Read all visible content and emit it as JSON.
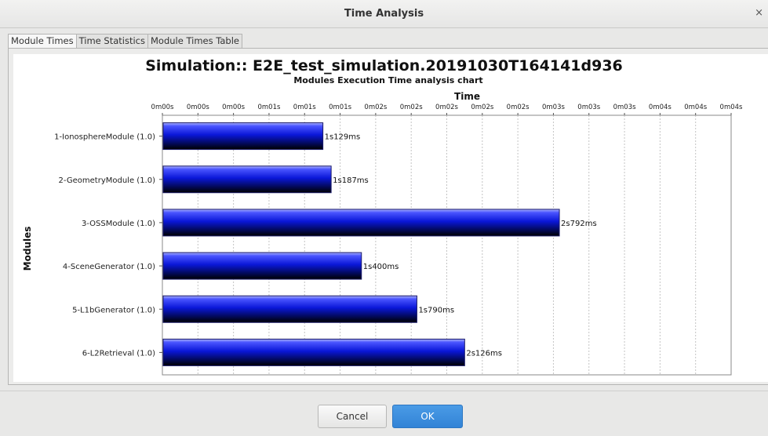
{
  "window": {
    "title": "Time Analysis",
    "close_glyph": "×"
  },
  "tabs": [
    {
      "label": "Module Times",
      "active": true
    },
    {
      "label": "Time Statistics",
      "active": false
    },
    {
      "label": "Module Times Table",
      "active": false
    }
  ],
  "chart_data": {
    "type": "bar",
    "orientation": "horizontal",
    "title": "Simulation:: E2E_test_simulation.20191030T164141d936",
    "subtitle": "Modules Execution Time analysis chart",
    "xlabel": "Time",
    "ylabel": "Modules",
    "x_tick_labels": [
      "0m00s",
      "0m00s",
      "0m00s",
      "0m01s",
      "0m01s",
      "0m01s",
      "0m02s",
      "0m02s",
      "0m02s",
      "0m02s",
      "0m02s",
      "0m03s",
      "0m03s",
      "0m03s",
      "0m04s",
      "0m04s",
      "0m04s"
    ],
    "xlim": [
      0,
      4.0
    ],
    "categories": [
      "1-IonosphereModule (1.0)",
      "2-GeometryModule (1.0)",
      "3-OSSModule (1.0)",
      "4-SceneGenerator (1.0)",
      "5-L1bGenerator (1.0)",
      "6-L2Retrieval (1.0)"
    ],
    "values": [
      1.129,
      1.187,
      2.792,
      1.4,
      1.79,
      2.126
    ],
    "value_labels": [
      "1s129ms",
      "1s187ms",
      "2s792ms",
      "1s400ms",
      "1s790ms",
      "2s126ms"
    ],
    "grid": "vertical-dashed",
    "bar_color": "#0a17d8"
  },
  "buttons": {
    "cancel": "Cancel",
    "ok": "OK"
  }
}
